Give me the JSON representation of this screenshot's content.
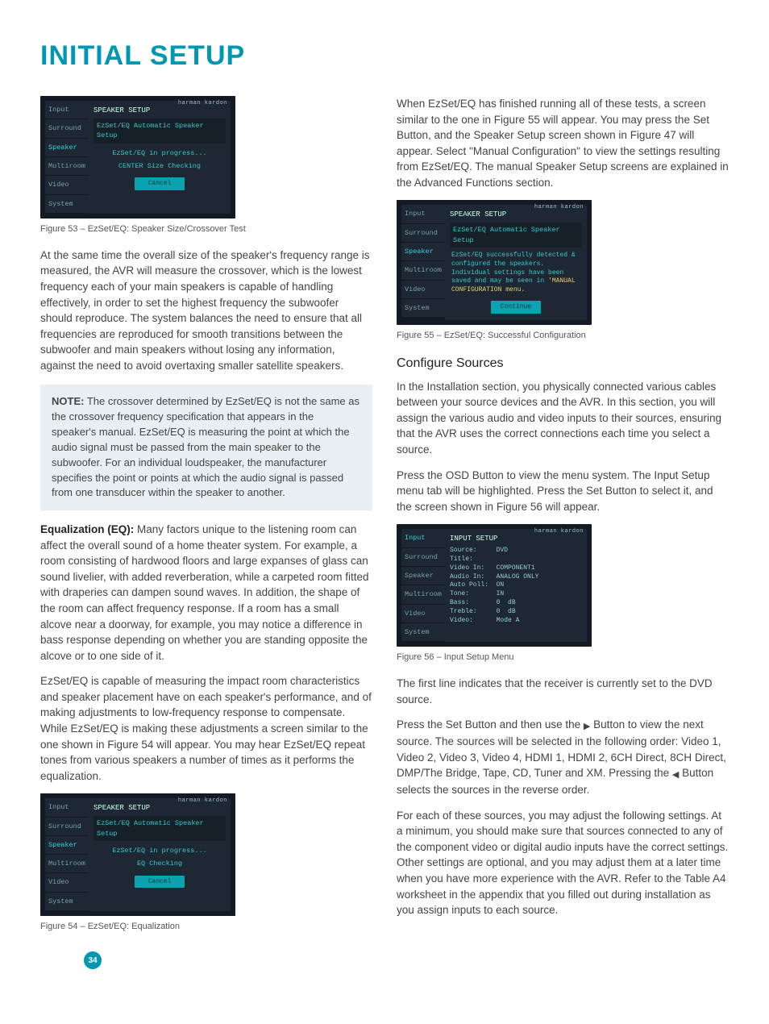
{
  "page": {
    "title": "INITIAL SETUP",
    "number": "34"
  },
  "osd_common": {
    "brand": "harman kardon",
    "tabs": [
      "Input",
      "Surround",
      "Speaker",
      "Multiroom",
      "Video",
      "System"
    ]
  },
  "fig53": {
    "caption": "Figure 53 – EzSet/EQ: Speaker Size/Crossover Test",
    "title": "SPEAKER SETUP",
    "sub": "EzSet/EQ Automatic Speaker Setup",
    "line1": "EzSet/EQ in progress...",
    "line2": "CENTER Size Checking",
    "button": "Cancel"
  },
  "left": {
    "p1": "At the same time the overall size of the speaker's frequency range is measured, the AVR will measure the crossover, which is the lowest frequency each of your main speakers is capable of handling effectively, in order to set the highest frequency the subwoofer should reproduce. The system balances the need to ensure that all frequencies are reproduced for smooth transitions between the subwoofer and main speakers without losing any information, against the need to avoid overtaxing smaller satellite speakers.",
    "note_label": "NOTE:",
    "note": " The crossover determined by EzSet/EQ is not the same as the crossover frequency specification that appears in the speaker's manual. EzSet/EQ is measuring the point at which the audio signal must be passed from the main speaker to the subwoofer. For an individual loudspeaker, the manufacturer specifies the point or points at which the audio signal is passed from one transducer within the speaker to another.",
    "eq_label": "Equalization (EQ):",
    "eq_text": " Many factors unique to the listening room can affect the overall sound of a home theater system. For example, a room consisting of hardwood floors and large expanses of glass can sound livelier, with added reverberation, while a carpeted room fitted with draperies can dampen sound waves. In addition, the shape of the room can affect frequency response. If a room has a small alcove near a doorway, for example, you may notice a difference in bass response depending on whether you are standing opposite the alcove or to one side of it.",
    "p2": "EzSet/EQ is capable of measuring the impact room characteristics and speaker placement have on each speaker's performance, and of making adjustments to low-frequency response to compensate. While EzSet/EQ is making these adjustments a screen similar to the one shown in Figure 54 will appear. You may hear EzSet/EQ repeat tones from various speakers a number of times as it performs the equalization."
  },
  "fig54": {
    "caption": "Figure 54 – EzSet/EQ: Equalization",
    "title": "SPEAKER SETUP",
    "sub": "EzSet/EQ Automatic Speaker Setup",
    "line1": "EzSet/EQ in progress...",
    "line2": "EQ Checking",
    "button": "Cancel"
  },
  "right": {
    "p1": "When EzSet/EQ has finished running all of these tests, a screen similar to the one in Figure 55 will appear. You may press the Set Button, and the Speaker Setup screen shown in Figure 47 will appear. Select \"Manual Configuration\" to view the settings resulting from EzSet/EQ. The manual Speaker Setup screens are explained in the Advanced Functions section.",
    "h_configure": "Configure Sources",
    "p2": "In the Installation section, you physically connected various cables between your source devices and the AVR. In this section, you will assign the various audio and video inputs to their sources, ensuring that the AVR uses the correct connections each time you select a source.",
    "p3": "Press the OSD Button to view the menu system. The Input Setup menu tab will be highlighted. Press the Set Button to select it, and the screen shown in Figure 56 will appear.",
    "p4": "The first line indicates that the receiver is currently set to the DVD source.",
    "p5a": "Press the Set Button and then use the ",
    "p5b": " Button to view the next source. The sources will be selected in the following order: Video 1, Video 2, Video 3, Video 4, HDMI 1, HDMI 2, 6CH Direct, 8CH Direct, DMP/The Bridge, Tape, CD, Tuner and XM. Pressing the ",
    "p5c": " Button selects the sources in the reverse order.",
    "p6": "For each of these sources, you may adjust the following settings. At a minimum, you should make sure that sources connected to any of the component video or digital audio inputs have the correct settings. Other settings are optional, and you may adjust them at a later time when you have more experience with the AVR. Refer to the Table A4 worksheet in the appendix that you filled out during installation as you assign inputs to each source."
  },
  "fig55": {
    "caption": "Figure 55 – EzSet/EQ: Successful Configuration",
    "title": "SPEAKER SETUP",
    "sub": "EzSet/EQ Automatic Speaker Setup",
    "text_a": "EzSet/EQ successfully detected & configured the speakers. Individual settings have been saved and may be seen in ",
    "text_hl": "'MANUAL CONFIGURATION menu.",
    "button": "Continue"
  },
  "fig56": {
    "caption": "Figure 56 – Input Setup Menu",
    "title": "INPUT SETUP",
    "kv": "Source:     DVD\nTitle:\nVideo In:   COMPONENT1\nAudio In:   ANALOG ONLY\nAuto Poll:  ON\nTone:       IN\nBass:       0  dB\nTreble:     0  dB\nVideo:      Mode A"
  }
}
